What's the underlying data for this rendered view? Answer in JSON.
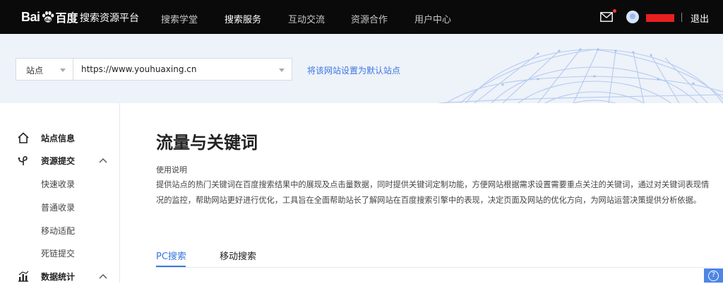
{
  "header": {
    "logo_text": "Bai百度",
    "platform_title": "搜索资源平台",
    "nav": [
      {
        "label": "搜索学堂"
      },
      {
        "label": "搜索服务"
      },
      {
        "label": "互动交流"
      },
      {
        "label": "资源合作"
      },
      {
        "label": "用户中心"
      }
    ],
    "logout_label": "退出"
  },
  "search": {
    "site_select_label": "站点",
    "url_value": "https://www.youhuaxing.cn",
    "set_default_link": "将该网站设置为默认站点"
  },
  "sidebar": {
    "items": [
      {
        "label": "站点信息",
        "icon": "home-icon"
      },
      {
        "label": "资源提交",
        "icon": "resource-submit-icon",
        "children": [
          "快速收录",
          "普通收录",
          "移动适配",
          "死链提交"
        ]
      },
      {
        "label": "数据统计",
        "icon": "bar-chart-icon"
      }
    ]
  },
  "main": {
    "title": "流量与关键词",
    "usage_heading": "使用说明",
    "description": "提供站点的热门关键词在百度搜索结果中的展现及点击量数据，同时提供关键词定制功能，方便网站根据需求设置需要重点关注的关键词，通过对关键词表现情况的监控，帮助网站更好进行优化，工具旨在全面帮助站长了解网站在百度搜索引擎中的表现，决定页面及网站的优化方向，为网站运营决策提供分析依据。",
    "tabs": [
      {
        "label": "PC搜索",
        "active": true
      },
      {
        "label": "移动搜索",
        "active": false
      }
    ]
  },
  "colors": {
    "topbar": "#0a0a0a",
    "accent": "#3a77e0",
    "band": "#eef2f9",
    "notification_dot": "#f23a3a",
    "redacted": "#e81f1f"
  }
}
